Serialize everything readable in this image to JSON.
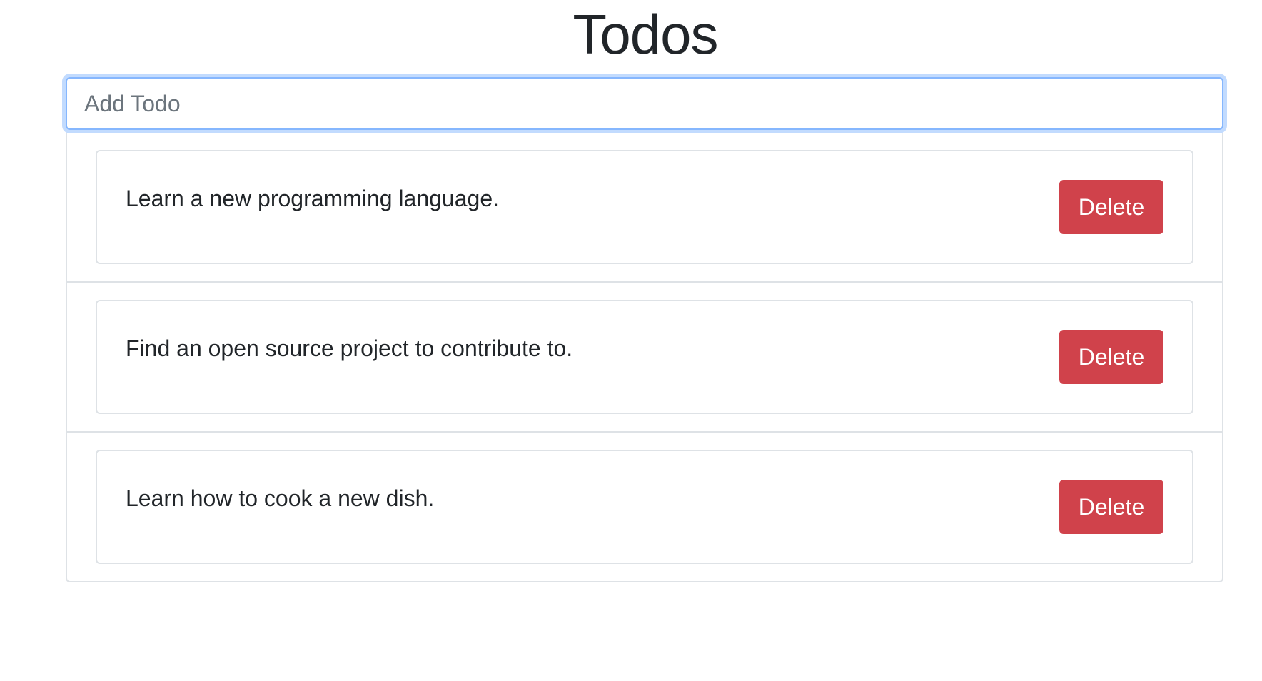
{
  "header": {
    "title": "Todos"
  },
  "add_todo": {
    "placeholder": "Add Todo",
    "value": ""
  },
  "todos": [
    {
      "text": "Learn a new programming language.",
      "delete_label": "Delete"
    },
    {
      "text": "Find an open source project to contribute to.",
      "delete_label": "Delete"
    },
    {
      "text": "Learn how to cook a new dish.",
      "delete_label": "Delete"
    }
  ],
  "colors": {
    "delete_button": "#d0424b",
    "input_focus_border": "#86b7fe",
    "border": "#dee2e6"
  }
}
